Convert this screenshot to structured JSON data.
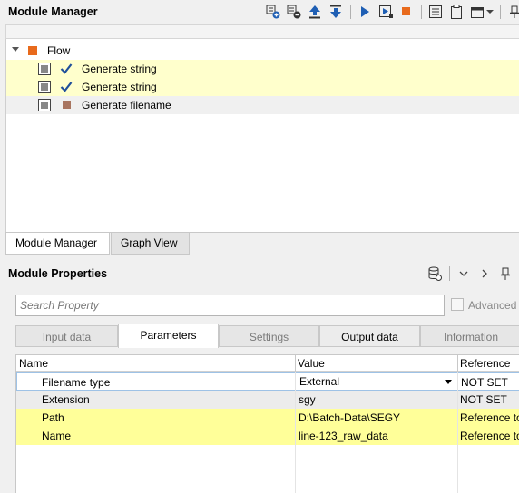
{
  "module_manager": {
    "title": "Module Manager",
    "toolbar_icons": [
      "add-module-icon",
      "remove-module-icon",
      "move-up-icon",
      "move-down-icon",
      "run-icon",
      "run-step-icon",
      "stop-icon",
      "list-icon",
      "clipboard-icon",
      "window-options-icon",
      "pin-icon"
    ],
    "tree": {
      "root_label": "Flow",
      "items": [
        {
          "label": "Generate string",
          "status": "checkmark",
          "highlight": "yellow"
        },
        {
          "label": "Generate string",
          "status": "checkmark",
          "highlight": "yellow"
        },
        {
          "label": "Generate filename",
          "status": "square",
          "highlight": "grey"
        }
      ]
    },
    "tabs": [
      "Module Manager",
      "Graph View"
    ],
    "active_tab": "Module Manager"
  },
  "module_properties": {
    "title": "Module Properties",
    "search_placeholder": "Search Property",
    "advanced_label": "Advanced",
    "tabs": [
      "Input data",
      "Parameters",
      "Settings",
      "Output data",
      "Information"
    ],
    "active_tab": "Parameters",
    "columns": [
      "Name",
      "Value",
      "Reference"
    ],
    "rows": [
      {
        "name": "Filename type",
        "value": "External",
        "reference": "NOT SET"
      },
      {
        "name": "Extension",
        "value": "sgy",
        "reference": "NOT SET"
      },
      {
        "name": "Path",
        "value": "D:\\Batch-Data\\SEGY",
        "reference": "Reference to"
      },
      {
        "name": "Name",
        "value": "line-123_raw_data",
        "reference": "Reference to"
      }
    ]
  },
  "colors": {
    "flow_square": "#e86a1c",
    "module_square": "#a87560",
    "yellow_highlight": "#ffff99",
    "run_blue": "#1f5fb4",
    "stop_orange": "#e86a1c"
  }
}
